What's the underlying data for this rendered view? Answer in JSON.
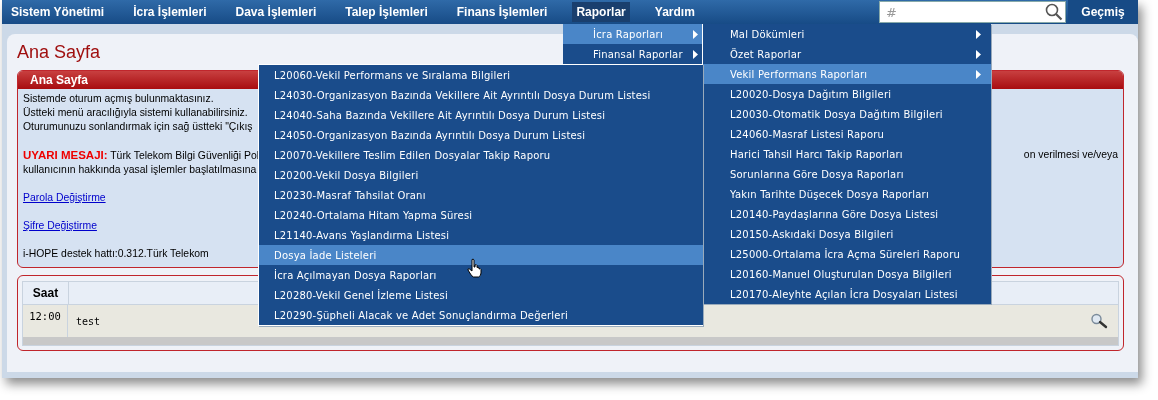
{
  "nav": {
    "items": [
      {
        "label": "Sistem Yönetimi",
        "selected": false
      },
      {
        "label": "İcra İşlemleri",
        "selected": false
      },
      {
        "label": "Dava İşlemleri",
        "selected": false
      },
      {
        "label": "Talep İşlemleri",
        "selected": false
      },
      {
        "label": "Finans İşlemleri",
        "selected": false
      },
      {
        "label": "Raporlar",
        "selected": true
      },
      {
        "label": "Yardım",
        "selected": false
      }
    ],
    "search": {
      "placeholder": "#"
    },
    "history_button": "Geçmiş"
  },
  "page": {
    "title": "Ana Sayfa",
    "panel": {
      "title": "Ana Sayfa",
      "intro": [
        "Sistemde oturum açmış bulunmaktasınız.",
        "Üstteki menü aracılığıyla sistemi kullanabilirsiniz.",
        "Oturumunuzu sonlandırmak için sağ üstteki \"Çıkış"
      ],
      "warning_left": "**UYARI MESAJI:** Türk Telekom Bilgi Güvenliği Pol",
      "warning_right": "on verilmesi ve/veya",
      "warning_line2": "kullanıcının hakkında yasal işlemler başlatılmasına",
      "links": [
        "Parola Değiştirme",
        "Şifre Değiştirme"
      ],
      "support": "i-HOPE destek hattı:0.312.Türk Telekom"
    },
    "table": {
      "columns": [
        "Saat"
      ],
      "rows": [
        {
          "time": "12:00",
          "text": "test"
        }
      ]
    }
  },
  "menus": [
    {
      "items": [
        {
          "label": "İcra Raporları",
          "has_submenu": true,
          "selected": true
        },
        {
          "label": "Finansal Raporlar",
          "has_submenu": true,
          "selected": false
        }
      ]
    },
    {
      "items": [
        {
          "label": "Mal Dökümleri",
          "has_submenu": true,
          "selected": false
        },
        {
          "label": "Özet Raporlar",
          "has_submenu": true,
          "selected": false
        },
        {
          "label": "Vekil Performans Raporları",
          "has_submenu": true,
          "selected": true
        },
        {
          "label": "L20020-Dosya Dağıtım Bilgileri",
          "has_submenu": false,
          "selected": false
        },
        {
          "label": "L20030-Otomatik Dosya Dağıtım Bilgileri",
          "has_submenu": false,
          "selected": false
        },
        {
          "label": "L24060-Masraf Listesi Raporu",
          "has_submenu": false,
          "selected": false
        },
        {
          "label": "Harici Tahsil Harcı Takip Raporları",
          "has_submenu": false,
          "selected": false
        },
        {
          "label": "Sorunlarına Göre Dosya Raporları",
          "has_submenu": false,
          "selected": false
        },
        {
          "label": "Yakın Tarihte Düşecek Dosya Raporları",
          "has_submenu": false,
          "selected": false
        },
        {
          "label": "L20140-Paydaşlarına Göre Dosya Listesi",
          "has_submenu": false,
          "selected": false
        },
        {
          "label": "L20150-Askıdaki Dosya Bilgileri",
          "has_submenu": false,
          "selected": false
        },
        {
          "label": "L25000-Ortalama İcra Açma Süreleri Raporu",
          "has_submenu": false,
          "selected": false
        },
        {
          "label": "L20160-Manuel Oluşturulan Dosya Bilgileri",
          "has_submenu": false,
          "selected": false
        },
        {
          "label": "L20170-Aleyhte Açılan İcra Dosyaları Listesi",
          "has_submenu": false,
          "selected": false
        }
      ]
    },
    {
      "items": [
        {
          "label": "L20060-Vekil Performans ve Sıralama Bilgileri",
          "has_submenu": false,
          "selected": false
        },
        {
          "label": "L24030-Organizasyon Bazında Vekillere Ait Ayrıntılı Dosya Durum Listesi",
          "has_submenu": false,
          "selected": false
        },
        {
          "label": "L24040-Saha Bazında Vekillere Ait Ayrıntılı Dosya Durum Listesi",
          "has_submenu": false,
          "selected": false
        },
        {
          "label": "L24050-Organizasyon Bazında Ayrıntılı Dosya Durum Listesi",
          "has_submenu": false,
          "selected": false
        },
        {
          "label": "L20070-Vekillere Teslim Edilen Dosyalar Takip Raporu",
          "has_submenu": false,
          "selected": false
        },
        {
          "label": "L20200-Vekil Dosya Bilgileri",
          "has_submenu": false,
          "selected": false
        },
        {
          "label": "L20230-Masraf Tahsilat Oranı",
          "has_submenu": false,
          "selected": false
        },
        {
          "label": "L20240-Ortalama Hitam Yapma Süresi",
          "has_submenu": false,
          "selected": false
        },
        {
          "label": "L21140-Avans Yaşlandırma Listesi",
          "has_submenu": false,
          "selected": false
        },
        {
          "label": "Dosya İade Listeleri",
          "has_submenu": false,
          "selected": true
        },
        {
          "label": "İcra Açılmayan Dosya Raporları",
          "has_submenu": false,
          "selected": false
        },
        {
          "label": "L20280-Vekil Genel İzleme Listesi",
          "has_submenu": false,
          "selected": false
        },
        {
          "label": "L20290-Şüpheli Alacak ve Adet Sonuçlandırma Değerleri",
          "has_submenu": false,
          "selected": false
        }
      ]
    }
  ]
}
